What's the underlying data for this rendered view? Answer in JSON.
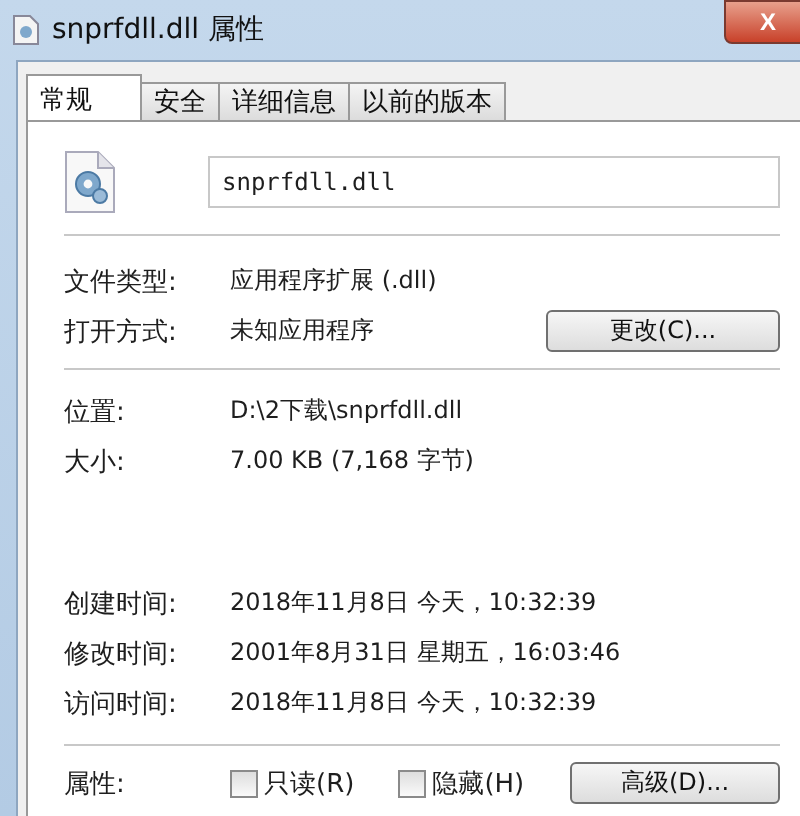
{
  "window": {
    "title": "snprfdll.dll 属性",
    "close": "X"
  },
  "tabs": [
    {
      "label": "常规",
      "selected": true
    },
    {
      "label": "安全",
      "selected": false
    },
    {
      "label": "详细信息",
      "selected": false
    },
    {
      "label": "以前的版本",
      "selected": false
    }
  ],
  "file_name": "snprfdll.dll",
  "type_section": [
    {
      "label": "文件类型:",
      "value": "应用程序扩展 (.dll)"
    },
    {
      "label": "打开方式:",
      "value": "未知应用程序",
      "button": "更改(C)..."
    }
  ],
  "location_section": [
    {
      "label": "位置:",
      "value": "D:\\2下载\\snprfdll.dll"
    },
    {
      "label": "大小:",
      "value": "7.00 KB (7,168 字节)"
    }
  ],
  "time_section": [
    {
      "label": "创建时间:",
      "value": "2018年11月8日 今天，10:32:39"
    },
    {
      "label": "修改时间:",
      "value": "2001年8月31日 星期五，16:03:46"
    },
    {
      "label": "访问时间:",
      "value": "2018年11月8日 今天，10:32:39"
    }
  ],
  "attributes": {
    "label": "属性:",
    "checkboxes": [
      {
        "label": "只读(R)",
        "checked": false
      },
      {
        "label": "隐藏(H)",
        "checked": false
      }
    ],
    "button": "高级(D)..."
  }
}
